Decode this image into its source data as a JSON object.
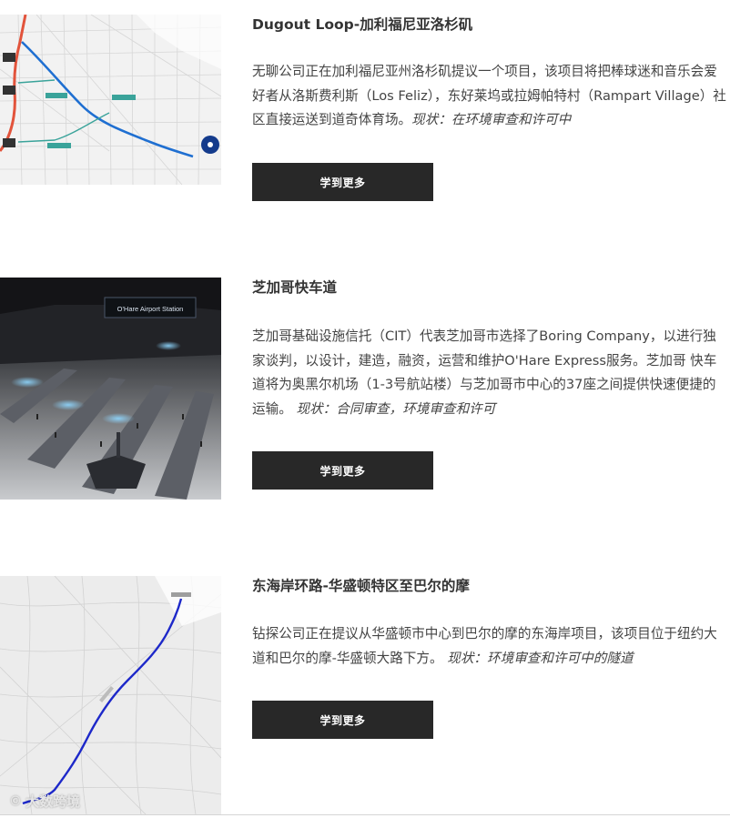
{
  "projects": [
    {
      "title": "Dugout Loop-加利福尼亚洛杉矶",
      "description": "无聊公司正在加利福尼亚州洛杉矶提议一个项目，该项目将把棒球迷和音乐会爱好者从洛斯费利斯（Los Feliz），东好莱坞或拉姆帕特村（Rampart Village）社区直接运送到道奇体育场。",
      "status": "现状：在环境审查和许可中",
      "button_label": "学到更多",
      "image_icon": "los-angeles-route-map"
    },
    {
      "title": "芝加哥快车道",
      "description": "芝加哥基础设施信托（CIT）代表芝加哥市选择了Boring Company，以进行独家谈判，以设计，建造，融资，运营和维护O'Hare Express服务。芝加哥 快车道将为奥黑尔机场（1-3号航站楼）与芝加哥市中心的37座之间提供快速便捷的运输。",
      "status": "现状：合同审查，环境审查和许可",
      "button_label": "学到更多",
      "image_icon": "ohare-station-render",
      "image_sign": "O'Hare Airport Station"
    },
    {
      "title": "东海岸环路-华盛顿特区至巴尔的摩",
      "description": "钻探公司正在提议从华盛顿市中心到巴尔的摩的东海岸项目，该项目位于纽约大道和巴尔的摩-华盛顿大路下方。",
      "status": "现状：环境审查和许可中的隧道",
      "button_label": "学到更多",
      "image_icon": "dc-baltimore-route-map"
    }
  ],
  "watermark": {
    "text": "大数跨境",
    "icon": "camera-swirl-icon"
  },
  "colors": {
    "button_bg": "#282828",
    "route_blue": "#1f6fd1",
    "route_teal": "#3aa39a",
    "route_red": "#e2533b",
    "route_navy": "#1d28c9"
  }
}
